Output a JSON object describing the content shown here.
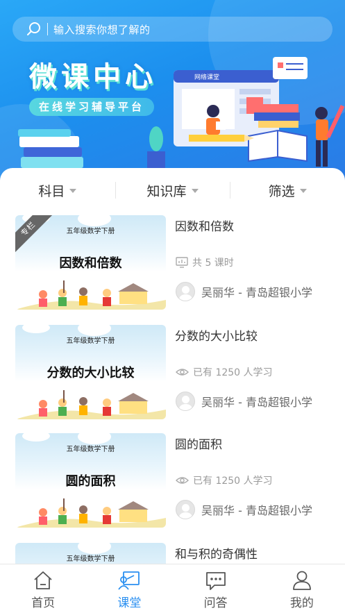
{
  "search": {
    "placeholder": "输入搜索你想了解的"
  },
  "banner": {
    "title": "微课中心",
    "subtitle": "在线学习辅导平台",
    "screen_label": "网络课堂"
  },
  "filters": [
    {
      "label": "科目"
    },
    {
      "label": "知识库"
    },
    {
      "label": "筛选"
    }
  ],
  "courses": [
    {
      "title": "因数和倍数",
      "thumb_grade": "五年级数学下册",
      "thumb_title": "因数和倍数",
      "badge": "专栏",
      "meta_icon": "lesson-icon",
      "meta": "共 5 课时",
      "author": "吴丽华 - 青岛超银小学"
    },
    {
      "title": "分数的大小比较",
      "thumb_grade": "五年级数学下册",
      "thumb_title": "分数的大小比较",
      "meta_icon": "eye-icon",
      "meta": "已有 1250 人学习",
      "author": "吴丽华 - 青岛超银小学"
    },
    {
      "title": "圆的面积",
      "thumb_grade": "五年级数学下册",
      "thumb_title": "圆的面积",
      "meta_icon": "eye-icon",
      "meta": "已有 1250 人学习",
      "author": "吴丽华 - 青岛超银小学"
    },
    {
      "title": "和与积的奇偶性",
      "thumb_grade": "五年级数学下册"
    }
  ],
  "tabs": [
    {
      "label": "首页",
      "icon": "home-icon",
      "active": false
    },
    {
      "label": "课堂",
      "icon": "classroom-icon",
      "active": true
    },
    {
      "label": "问答",
      "icon": "chat-icon",
      "active": false
    },
    {
      "label": "我的",
      "icon": "user-icon",
      "active": false
    }
  ],
  "colors": {
    "primary": "#2a8ff0",
    "banner": "#1c8fee",
    "muted": "#9a9a9a"
  }
}
